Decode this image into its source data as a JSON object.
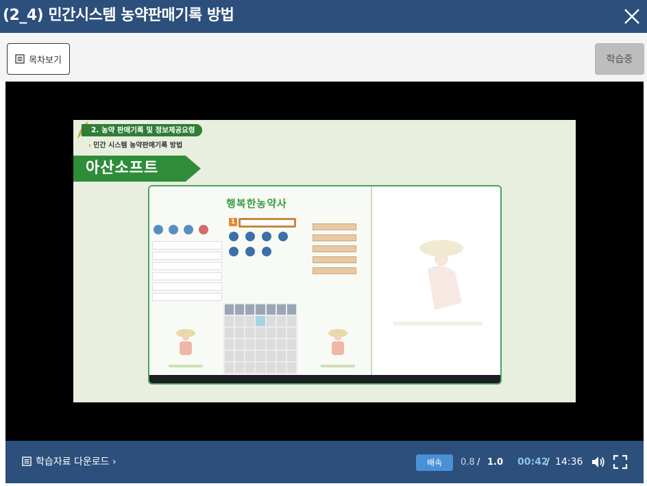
{
  "header": {
    "title": "(2_4) 민간시스템 농약판매기록 방법"
  },
  "toolbar": {
    "toc_label": "목차보기",
    "study_status": "학습중"
  },
  "slide": {
    "breadcrumb_main": "2. 농약 판매기록 및 정보제공요령",
    "breadcrumb_sub": "민간 시스템 농약판매기록 방법",
    "banner": "아산소프트",
    "app_title": "행복한농약사",
    "step_number": "1"
  },
  "footer": {
    "download_label": "학습자료 다운로드 ›",
    "speed_button": "배속",
    "speed_slow": "0.8",
    "speed_sep": "/",
    "speed_current": "1.0",
    "time_current": "00:42",
    "time_sep": "/",
    "time_total": "14:36"
  },
  "colors": {
    "header_bg": "#2c4f7c",
    "accent_green": "#2f8d3a",
    "speed_btn": "#4a90d6",
    "time_current": "#8fc2ee"
  }
}
